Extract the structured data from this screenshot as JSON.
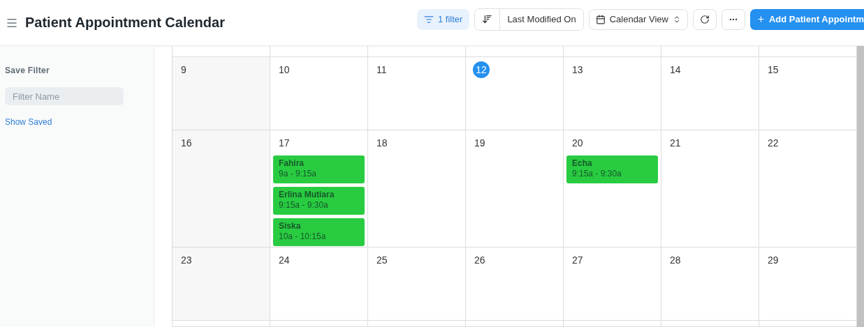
{
  "header": {
    "title": "Patient Appointment Calendar"
  },
  "toolbar": {
    "filter": "1 filter",
    "sort": "Last Modified On",
    "view": "Calendar View",
    "add": "Add Patient Appointm"
  },
  "sidebar": {
    "heading": "Save Filter",
    "filter_name": {
      "placeholder": "Filter Name"
    },
    "link": "Show Saved"
  },
  "weeks": [
    {
      "days": [
        {
          "day": "9",
          "today": false
        },
        {
          "day": "10",
          "today": false
        },
        {
          "day": "11",
          "today": false
        },
        {
          "day": "12",
          "today": true
        },
        {
          "day": "13",
          "today": false
        },
        {
          "day": "14",
          "today": false
        },
        {
          "day": "15",
          "today": false
        }
      ]
    },
    {
      "days": [
        {
          "day": "16",
          "today": false
        },
        {
          "day": "17",
          "today": false,
          "events": [
            {
              "title": "Fahira",
              "time": "9a - 9:15a"
            },
            {
              "title": "Erlina Mutiara",
              "time": "9:15a - 9:30a"
            },
            {
              "title": "Siska",
              "time": "10a - 10:15a"
            }
          ]
        },
        {
          "day": "18",
          "today": false
        },
        {
          "day": "19",
          "today": false
        },
        {
          "day": "20",
          "today": false,
          "events": [
            {
              "title": "Echa",
              "time": "9:15a - 9:30a"
            }
          ]
        },
        {
          "day": "21",
          "today": false
        },
        {
          "day": "22",
          "today": false
        }
      ]
    },
    {
      "days": [
        {
          "day": "23",
          "today": false
        },
        {
          "day": "24",
          "today": false
        },
        {
          "day": "25",
          "today": false
        },
        {
          "day": "26",
          "today": false
        },
        {
          "day": "27",
          "today": false
        },
        {
          "day": "28",
          "today": false
        },
        {
          "day": "29",
          "today": false
        }
      ]
    }
  ]
}
